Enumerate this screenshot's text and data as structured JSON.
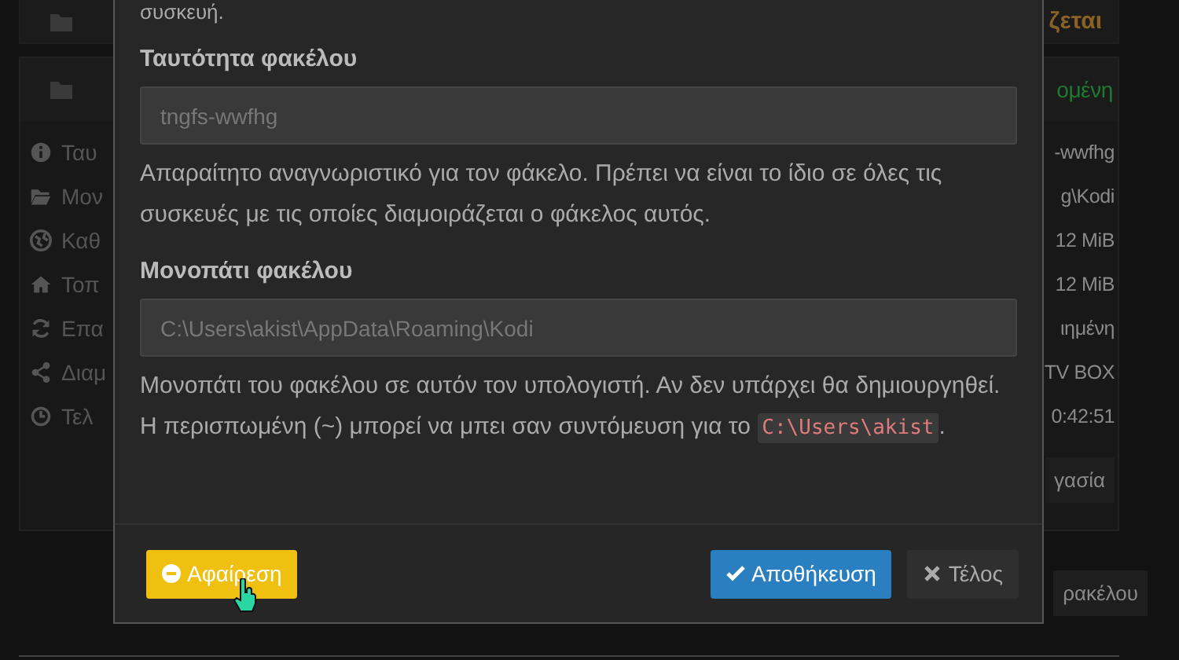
{
  "background": {
    "top_panel": {
      "status": "ζεται"
    },
    "folder_panel": {
      "status": "ομένη",
      "rows": [
        {
          "label": "Ταυ",
          "value": "-wwfhg"
        },
        {
          "label": "Μον",
          "value": "g\\Kodi"
        },
        {
          "label": "Καθ",
          "value": "12 MiB"
        },
        {
          "label": "Τοπ",
          "value": "12 MiB"
        },
        {
          "label": "Επα",
          "value": "ιημένη"
        },
        {
          "label": "Διαμ",
          "value": "TV BOX"
        },
        {
          "label": "Τελ",
          "value": "0:42:51"
        }
      ],
      "edit_button": "γασία"
    },
    "add_button": "ρακέλου"
  },
  "dialog": {
    "intro_tail": "συσκευή.",
    "fields": [
      {
        "label": "Ταυτότητα φακέλου",
        "value": "tngfs-wwfhg",
        "disabled": true,
        "help": "Απαραίτητο αναγνωριστικό για τον φάκελο. Πρέπει να είναι το ίδιο σε όλες τις συσκευές με τις οποίες διαμοιράζεται ο φάκελος αυτός."
      },
      {
        "label": "Μονοπάτι φακέλου",
        "value": "C:\\Users\\akist\\AppData\\Roaming\\Kodi",
        "disabled": true,
        "help": "Μονοπάτι του φακέλου σε αυτόν τον υπολογιστή. Αν δεν υπάρχει θα δημιουργηθεί. Η περισπωμένη (~) μπορεί να μπει σαν συντόμευση για το",
        "help_code": "C:\\Users\\akist",
        "help_end": "."
      }
    ],
    "buttons": [
      {
        "label": "Αφαίρεση",
        "kind": "warning"
      },
      {
        "label": "Αποθήκευση",
        "kind": "primary"
      },
      {
        "label": "Τέλος",
        "kind": "default"
      }
    ]
  }
}
